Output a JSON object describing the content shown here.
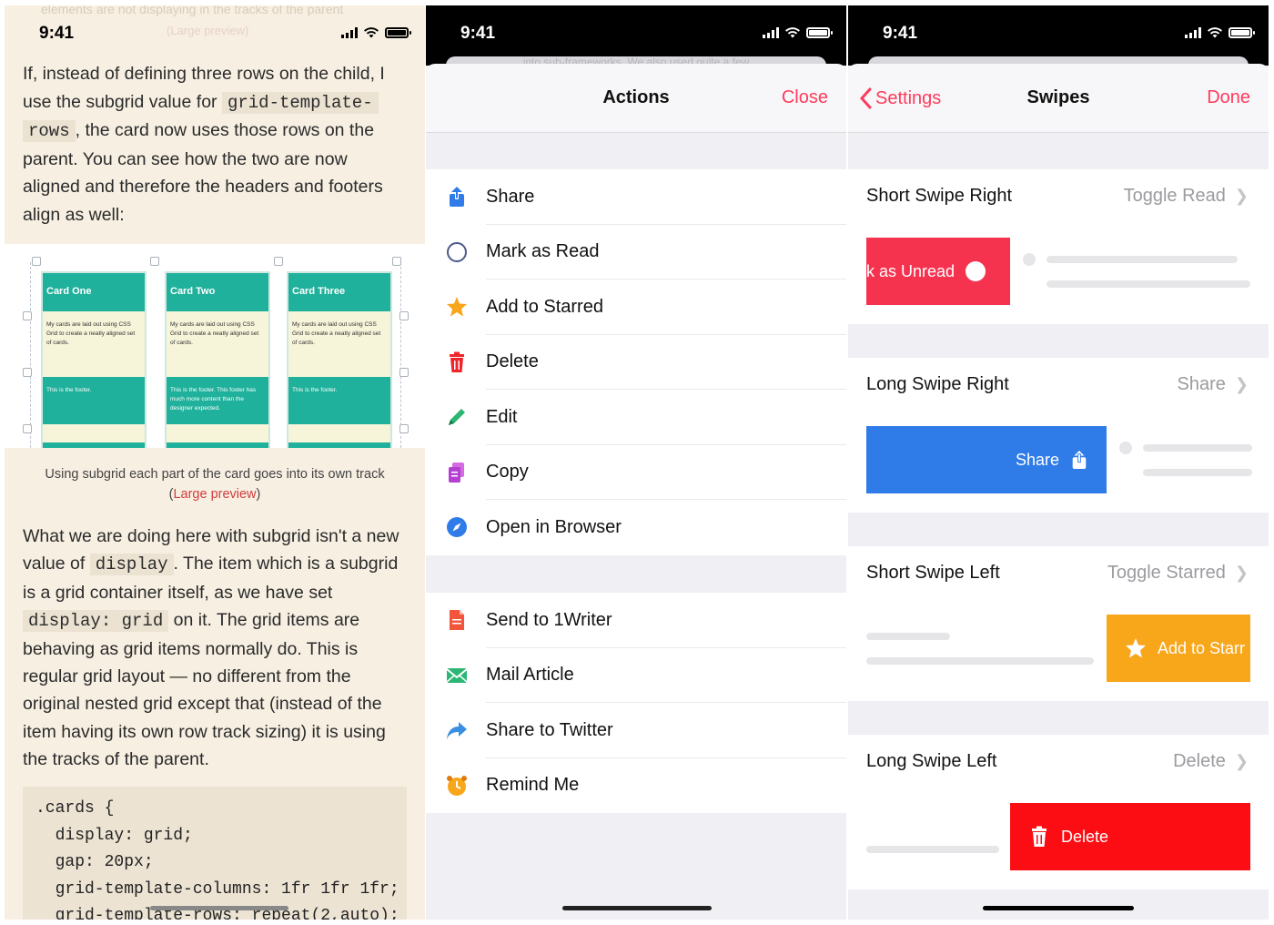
{
  "article": {
    "status_time": "9:41",
    "ghost_top": "elements are not displaying in the tracks of the parent",
    "ghost_top2": "(Large preview)",
    "para1_a": "If, instead of defining three rows on the child, I use the subgrid value for ",
    "para1_code1": "grid-template-",
    "para1_code2": "rows",
    "para1_b": ", the card now uses those rows on the parent. You can see how the two are now aligned and therefore the headers and footers align as well:",
    "cards": [
      {
        "title": "Card One",
        "body": "My cards are laid out using CSS Grid to create a neatly aligned set of cards.",
        "footer": "This is the footer."
      },
      {
        "title": "Card Two",
        "body": "My cards are laid out using CSS Grid to create a neatly aligned set of cards.",
        "footer": "This is the footer. This footer has much more content than the designer expected."
      },
      {
        "title": "Card Three",
        "body": "My cards are laid out using CSS Grid to create a neatly aligned set of cards.",
        "footer": "This is the footer."
      }
    ],
    "caption_text": "Using subgrid each part of the card goes into its own track",
    "caption_open": "(",
    "caption_link": "Large preview",
    "caption_close": ")",
    "para2_a": "What we are doing here with subgrid isn't a new value of ",
    "para2_code1": "display",
    "para2_b": ". The item which is a subgrid is a grid container itself, as we have set ",
    "para2_code2": "display: grid",
    "para2_c": " on it. The grid items are behaving as grid items normally do. This is regular grid layout — no different from the original nested grid except that (instead of the item having its own row track sizing) it is using the tracks of the parent.",
    "code_block": ".cards {\n  display: grid;\n  gap: 20px;\n  grid-template-columns: 1fr 1fr 1fr;\n  grid-template-rows: repeat(2,auto);"
  },
  "actions": {
    "status_time": "9:41",
    "ghost_text": "into sub-frameworks. We also used quite a few",
    "title": "Actions",
    "close_label": "Close",
    "group1": [
      {
        "label": "Share",
        "icon": "share-icon"
      },
      {
        "label": "Mark as Read",
        "icon": "circle-icon"
      },
      {
        "label": "Add to Starred",
        "icon": "star-icon"
      },
      {
        "label": "Delete",
        "icon": "trash-icon"
      },
      {
        "label": "Edit",
        "icon": "pencil-icon"
      },
      {
        "label": "Copy",
        "icon": "copy-icon"
      },
      {
        "label": "Open in Browser",
        "icon": "compass-icon"
      }
    ],
    "group2": [
      {
        "label": "Send to 1Writer",
        "icon": "document-icon"
      },
      {
        "label": "Mail Article",
        "icon": "mail-icon"
      },
      {
        "label": "Share to Twitter",
        "icon": "forward-arrow-icon"
      },
      {
        "label": "Remind Me",
        "icon": "alarm-clock-icon"
      }
    ]
  },
  "swipes": {
    "status_time": "9:41",
    "back_label": "Settings",
    "title": "Swipes",
    "done_label": "Done",
    "rows": [
      {
        "title": "Short Swipe Right",
        "value": "Toggle Read",
        "action_label": "k as Unread",
        "color": "#f6334f"
      },
      {
        "title": "Long Swipe Right",
        "value": "Share",
        "action_label": "Share",
        "color": "#2f7ce8"
      },
      {
        "title": "Short Swipe Left",
        "value": "Toggle Starred",
        "action_label": "Add to Starr",
        "color": "#f8a61a"
      },
      {
        "title": "Long Swipe Left",
        "value": "Delete",
        "action_label": "Delete",
        "color": "#fb0d13"
      }
    ]
  }
}
